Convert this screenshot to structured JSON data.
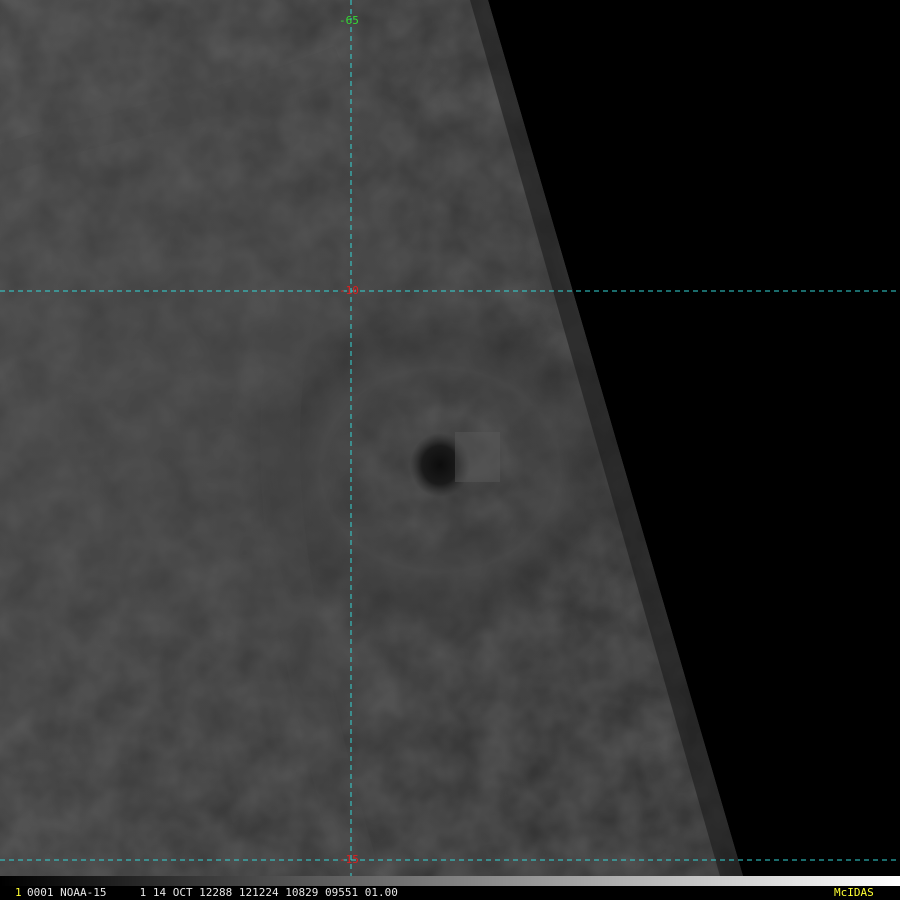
{
  "colors": {
    "grid_line": "#33d6d6",
    "longitude_label": "#33dd33",
    "latitude_label": "#e02020",
    "status_text": "#e8e8e8",
    "frame_number": "#ffff33",
    "brand": "#ffff33"
  },
  "grid": {
    "longitude_label": "-65",
    "latitude_labels": [
      "-10",
      "-15"
    ]
  },
  "status_bar": {
    "frame_number": "1",
    "text": "0001 NOAA-15     1 14 OCT 12288 121224 10829 09551 01.00",
    "brand": "McIDAS"
  }
}
